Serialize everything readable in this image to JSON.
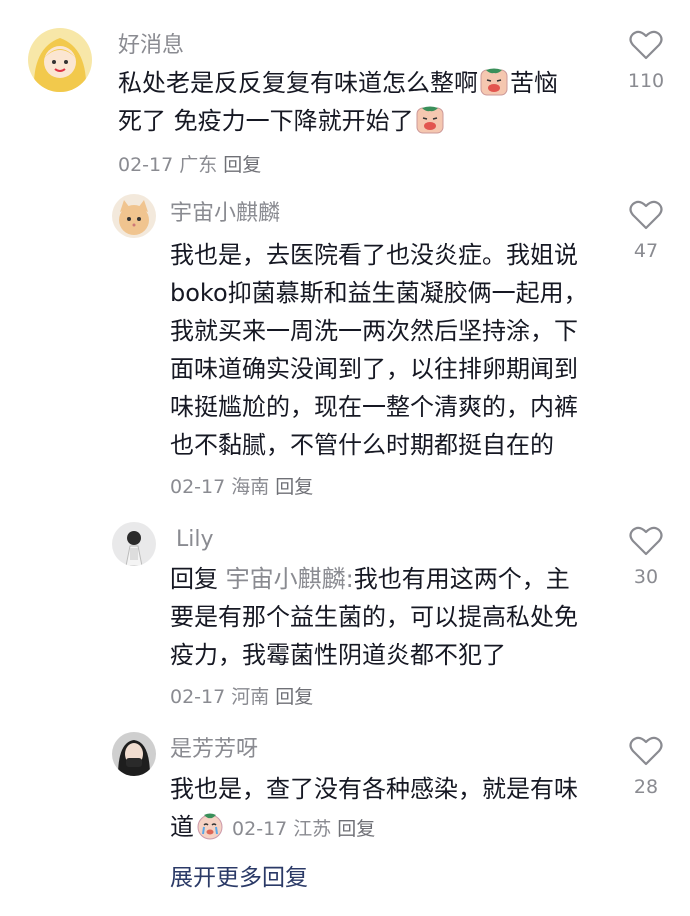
{
  "comments": [
    {
      "username": "好消息",
      "lines": [
        "私处老是反反复复有味道怎么整啊",
        "苦恼",
        "死了 免疫力一下降就开始了"
      ],
      "date": "02-17",
      "location": "广东",
      "reply_label": "回复",
      "likes": "110",
      "icon": "heart-outline-icon"
    },
    {
      "username": "宇宙小麒麟",
      "lines": [
        "我也是，去医院看了也没炎症。我姐说",
        "boko抑菌慕斯和益生菌凝胶俩一起用，",
        "我就买来一周洗一两次然后坚持涂，下",
        "面味道确实没闻到了，以往排卵期闻到",
        "味挺尴尬的，现在一整个清爽的，内裤",
        "也不黏腻，不管什么时期都挺自在的"
      ],
      "date": "02-17",
      "location": "海南",
      "reply_label": "回复",
      "likes": "47"
    },
    {
      "username": "Lily",
      "reply_prefix": "回复",
      "reply_target": "宇宙小麒麟:",
      "lines": [
        "我也有用这两个，主",
        "要是有那个益生菌的，可以提高私处免",
        "疫力，我霉菌性阴道炎都不犯了"
      ],
      "date": "02-17",
      "location": "河南",
      "reply_label": "回复",
      "likes": "30"
    },
    {
      "username": "是芳芳呀",
      "lines": [
        "我也是，查了没有各种感染，就是有味",
        "道"
      ],
      "date": "02-17",
      "location": "江苏",
      "reply_label": "回复",
      "likes": "28"
    }
  ],
  "expand_label": "展开更多回复",
  "colors": {
    "text": "#161823",
    "muted": "#8a8b91",
    "link": "#2b3a67"
  }
}
